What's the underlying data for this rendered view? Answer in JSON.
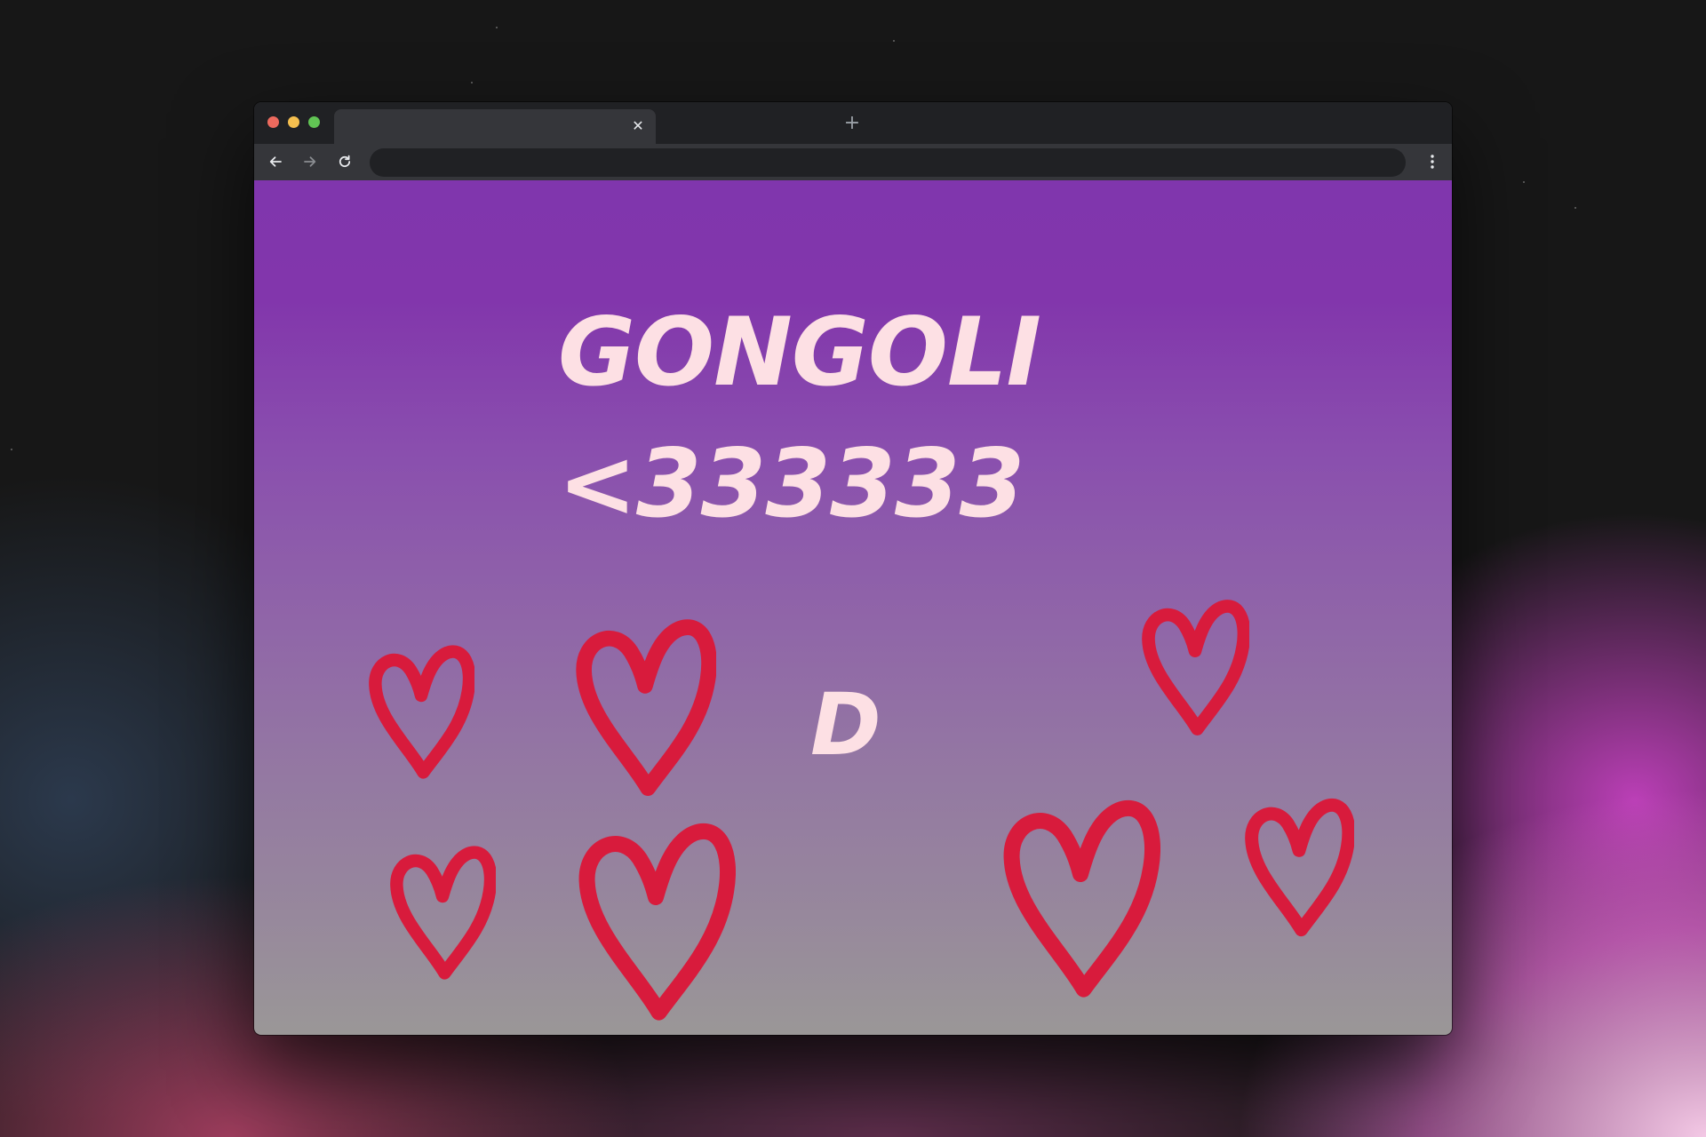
{
  "browser": {
    "tab_title": "",
    "tab_close_icon": "close-icon",
    "new_tab_icon": "plus-icon",
    "address_value": "",
    "nav_icons": [
      "arrow-left-icon",
      "arrow-right-icon",
      "reload-icon"
    ],
    "menu_icon": "kebab-menu-icon"
  },
  "page": {
    "title": "GONGOLI",
    "subtitle": "<333333",
    "letter": "D",
    "text_color": "#fde0e4",
    "heart_color": "#d81b3c",
    "gradient_top": "#8036ad",
    "gradient_bottom": "#9a9797"
  }
}
